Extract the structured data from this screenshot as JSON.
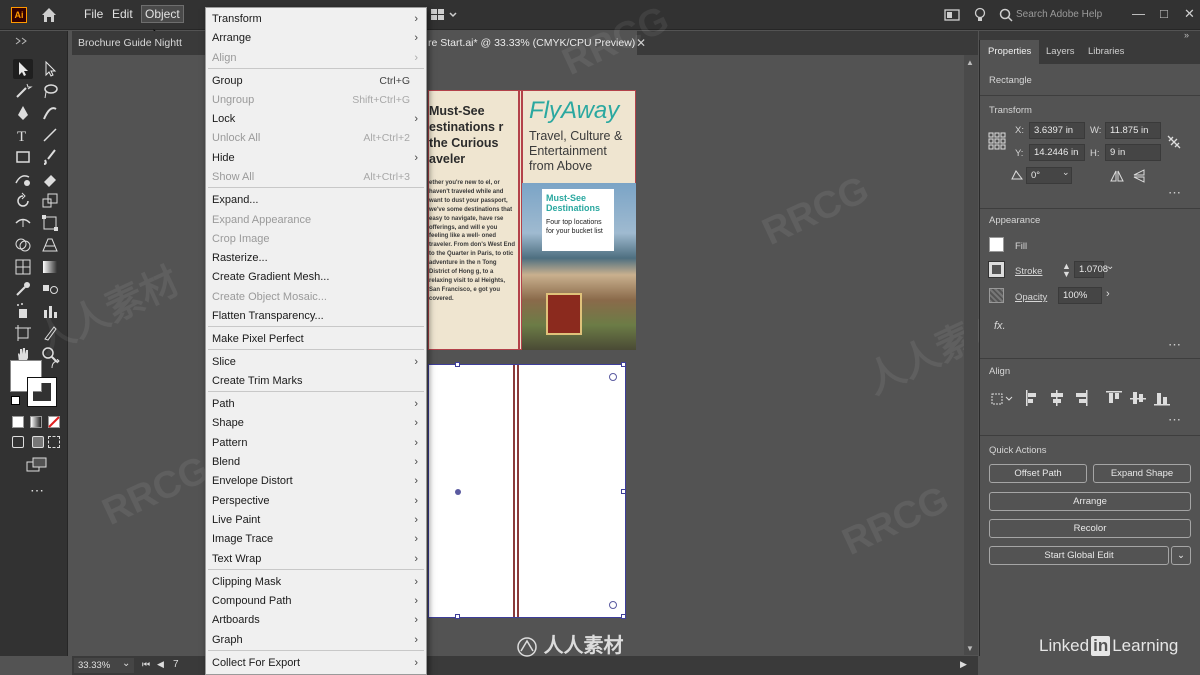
{
  "menubar": {
    "app_logo": "Ai",
    "items": [
      "File",
      "Edit",
      "Object"
    ],
    "search_placeholder": "Search Adobe Help"
  },
  "tabs": {
    "tab1": "Brochure Guide Nightt",
    "tab2": "re Start.ai* @ 33.33% (CMYK/CPU Preview)"
  },
  "object_menu": {
    "items": [
      {
        "label": "Transform",
        "shortcut": "",
        "submenu": true,
        "disabled": false
      },
      {
        "label": "Arrange",
        "shortcut": "",
        "submenu": true,
        "disabled": false
      },
      {
        "label": "Align",
        "shortcut": "",
        "submenu": true,
        "disabled": true
      },
      {
        "label": "Group",
        "shortcut": "Ctrl+G",
        "submenu": false,
        "disabled": false
      },
      {
        "label": "Ungroup",
        "shortcut": "Shift+Ctrl+G",
        "submenu": false,
        "disabled": true
      },
      {
        "label": "Lock",
        "shortcut": "",
        "submenu": true,
        "disabled": false
      },
      {
        "label": "Unlock All",
        "shortcut": "Alt+Ctrl+2",
        "submenu": false,
        "disabled": true
      },
      {
        "label": "Hide",
        "shortcut": "",
        "submenu": true,
        "disabled": false
      },
      {
        "label": "Show All",
        "shortcut": "Alt+Ctrl+3",
        "submenu": false,
        "disabled": true
      },
      {
        "label": "Expand...",
        "shortcut": "",
        "submenu": false,
        "disabled": false
      },
      {
        "label": "Expand Appearance",
        "shortcut": "",
        "submenu": false,
        "disabled": true
      },
      {
        "label": "Crop Image",
        "shortcut": "",
        "submenu": false,
        "disabled": true
      },
      {
        "label": "Rasterize...",
        "shortcut": "",
        "submenu": false,
        "disabled": false
      },
      {
        "label": "Create Gradient Mesh...",
        "shortcut": "",
        "submenu": false,
        "disabled": false
      },
      {
        "label": "Create Object Mosaic...",
        "shortcut": "",
        "submenu": false,
        "disabled": true
      },
      {
        "label": "Flatten Transparency...",
        "shortcut": "",
        "submenu": false,
        "disabled": false
      },
      {
        "label": "Make Pixel Perfect",
        "shortcut": "",
        "submenu": false,
        "disabled": false
      },
      {
        "label": "Slice",
        "shortcut": "",
        "submenu": true,
        "disabled": false
      },
      {
        "label": "Create Trim Marks",
        "shortcut": "",
        "submenu": false,
        "disabled": false
      },
      {
        "label": "Path",
        "shortcut": "",
        "submenu": true,
        "disabled": false
      },
      {
        "label": "Shape",
        "shortcut": "",
        "submenu": true,
        "disabled": false
      },
      {
        "label": "Pattern",
        "shortcut": "",
        "submenu": true,
        "disabled": false
      },
      {
        "label": "Blend",
        "shortcut": "",
        "submenu": true,
        "disabled": false
      },
      {
        "label": "Envelope Distort",
        "shortcut": "",
        "submenu": true,
        "disabled": false
      },
      {
        "label": "Perspective",
        "shortcut": "",
        "submenu": true,
        "disabled": false
      },
      {
        "label": "Live Paint",
        "shortcut": "",
        "submenu": true,
        "disabled": false
      },
      {
        "label": "Image Trace",
        "shortcut": "",
        "submenu": true,
        "disabled": false
      },
      {
        "label": "Text Wrap",
        "shortcut": "",
        "submenu": true,
        "disabled": false
      },
      {
        "label": "Clipping Mask",
        "shortcut": "",
        "submenu": true,
        "disabled": false
      },
      {
        "label": "Compound Path",
        "shortcut": "",
        "submenu": true,
        "disabled": false
      },
      {
        "label": "Artboards",
        "shortcut": "",
        "submenu": true,
        "disabled": false
      },
      {
        "label": "Graph",
        "shortcut": "",
        "submenu": true,
        "disabled": false
      },
      {
        "label": "Collect For Export",
        "shortcut": "",
        "submenu": true,
        "disabled": false
      }
    ]
  },
  "artboard": {
    "heading": "Must-See estinations r the Curious aveler",
    "body": "ether you're new to el, or haven't traveled while and want to dust your passport, we've some destinations that easy to navigate, have rse offerings, and will e you feeling like a well- oned traveler. From don's West End to the Quarter in Paris, to otic adventure in the n Tong District of Hong g, to a relaxing visit to al Heights, San Francisco, e got you covered.",
    "logo": "FlyAway",
    "tagline": "Travel, Culture & Entertainment from Above",
    "card_title": "Must-See Destinations",
    "card_sub": "Four top locations for your bucket list"
  },
  "right_panel": {
    "tabs": [
      "Properties",
      "Layers",
      "Libraries"
    ],
    "object_type": "Rectangle",
    "transform_title": "Transform",
    "x_label": "X:",
    "x_value": "3.6397 in",
    "y_label": "Y:",
    "y_value": "14.2446 in",
    "w_label": "W:",
    "w_value": "11.875 in",
    "h_label": "H:",
    "h_value": "9 in",
    "rotate_value": "0°",
    "appearance_title": "Appearance",
    "fill_label": "Fill",
    "stroke_label": "Stroke",
    "stroke_value": "1.0708",
    "opacity_label": "Opacity",
    "opacity_value": "100%",
    "fx_label": "fx.",
    "align_title": "Align",
    "quick_title": "Quick Actions",
    "btn_offset": "Offset Path",
    "btn_expand": "Expand Shape",
    "btn_arrange": "Arrange",
    "btn_recolor": "Recolor",
    "btn_global": "Start Global Edit"
  },
  "status": {
    "zoom": "33.33%",
    "page": "7"
  },
  "branding": {
    "linkedin_pre": "Linked",
    "linkedin_in": "in",
    "linkedin_post": "Learning",
    "center_logo": "人人素材",
    "watermark_a": "RRCG",
    "watermark_b": "人人素材"
  },
  "colors": {
    "accent_teal": "#2aa8a0",
    "artboard_border": "#b3424a",
    "ai_orange": "#ff9a00"
  }
}
